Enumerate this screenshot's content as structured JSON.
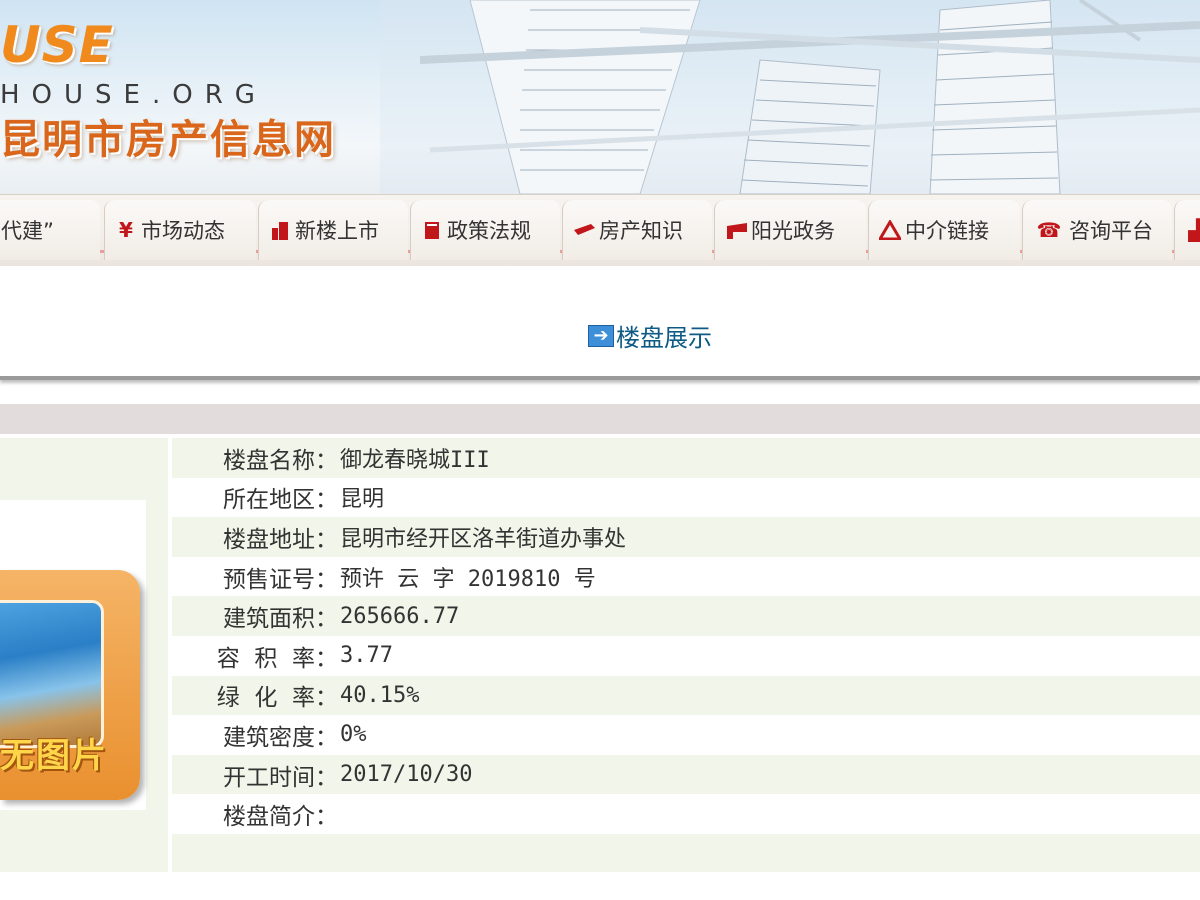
{
  "header": {
    "logo_mark": "USE",
    "logo_domain": "HOUSE.ORG",
    "site_title": "昆明市房产信息网"
  },
  "nav": {
    "items": [
      {
        "label": "代建”",
        "icon": "none"
      },
      {
        "label": "市场动态",
        "icon": "yen-icon"
      },
      {
        "label": "新楼上市",
        "icon": "building-icon"
      },
      {
        "label": "政策法规",
        "icon": "book-icon"
      },
      {
        "label": "房产知识",
        "icon": "pen-icon"
      },
      {
        "label": "阳光政务",
        "icon": "flag-icon"
      },
      {
        "label": "中介链接",
        "icon": "triangle-icon"
      },
      {
        "label": "咨询平台",
        "icon": "phone-icon"
      }
    ]
  },
  "section": {
    "title": "楼盘展示",
    "icon": "arrow-right-icon"
  },
  "thumbnail": {
    "text": "无图片"
  },
  "details": [
    {
      "key": "楼盘名称：",
      "value": "御龙春晓城III"
    },
    {
      "key": "所在地区：",
      "value": "昆明"
    },
    {
      "key": "楼盘地址：",
      "value": "昆明市经开区洛羊街道办事处"
    },
    {
      "key": "预售证号：",
      "value": "预许 云 字 2019810 号"
    },
    {
      "key": "建筑面积：",
      "value": "265666.77"
    },
    {
      "key": "容  积  率：",
      "value": "3.77"
    },
    {
      "key": "绿  化  率：",
      "value": "40.15%"
    },
    {
      "key": "建筑密度：",
      "value": "0%"
    },
    {
      "key": "开工时间：",
      "value": "2017/10/30"
    },
    {
      "key": "楼盘简介：",
      "value": ""
    }
  ],
  "colors": {
    "accent_orange": "#f08a1c",
    "title_orange": "#d9661a",
    "link_blue": "#0e5a86",
    "nav_red": "#c1171b",
    "row_tint": "#f2f5ea"
  }
}
